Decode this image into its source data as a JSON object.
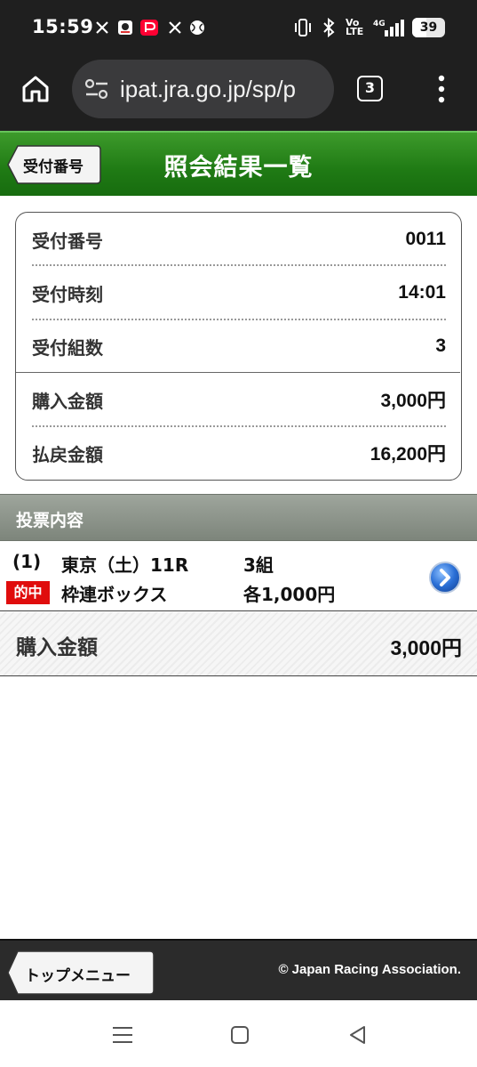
{
  "status_bar": {
    "time": "15:59",
    "notification_icons": [
      "x-icon",
      "app-icon",
      "paypay-icon",
      "x-icon",
      "ball-icon"
    ],
    "system_icons": [
      "vibrate-icon",
      "bluetooth-icon",
      "volte-icon",
      "signal-4g-icon"
    ],
    "volte_label": "Vo LTE",
    "network_label": "4G",
    "battery": "39"
  },
  "browser": {
    "url": "ipat.jra.go.jp/sp/p",
    "tab_count": "3"
  },
  "header": {
    "back_label": "受付番号",
    "title": "照会結果一覧"
  },
  "summary": {
    "rows": [
      {
        "label": "受付番号",
        "value": "0011"
      },
      {
        "label": "受付時刻",
        "value": "14:01"
      },
      {
        "label": "受付組数",
        "value": "3"
      },
      {
        "label": "購入金額",
        "value": "3,000円"
      },
      {
        "label": "払戻金額",
        "value": "16,200円"
      }
    ]
  },
  "section": {
    "title": "投票内容"
  },
  "bet": {
    "number": "(1)",
    "race": "東京（土）11R",
    "combos": "3組",
    "status_badge": "的中",
    "bet_type": "枠連ボックス",
    "amount_each": "各1,000円"
  },
  "total": {
    "label": "購入金額",
    "value": "3,000円"
  },
  "footer": {
    "top_menu_label": "トップメニュー",
    "copyright": "© Japan Racing Association."
  },
  "colors": {
    "header_green": "#1f7a14",
    "hit_red": "#e00d0d",
    "section_gray": "#8a9288",
    "arrow_blue": "#2a6fd6"
  }
}
